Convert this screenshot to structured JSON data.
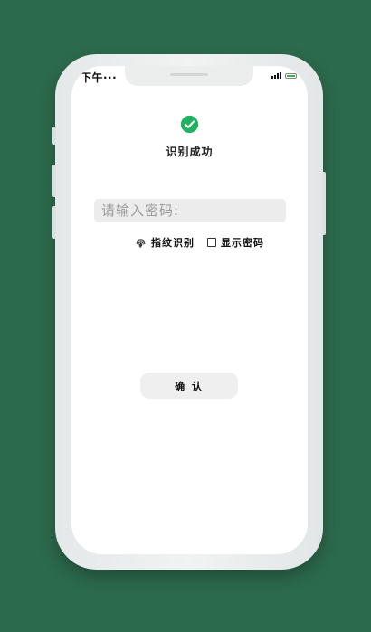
{
  "status_bar": {
    "time": "下午···",
    "signal_icon": "signal-icon",
    "battery_icon": "battery-icon"
  },
  "result": {
    "icon": "check-circle-icon",
    "message": "识别成功",
    "icon_color": "#1fb15f"
  },
  "password": {
    "placeholder": "请输入密码:",
    "value": ""
  },
  "options": {
    "fingerprint_label": "指纹识别",
    "show_password_label": "显示密码",
    "show_password_checked": false
  },
  "confirm_button": {
    "label": "确 认"
  },
  "colors": {
    "background": "#2c6a4d",
    "accent": "#1fb15f"
  }
}
